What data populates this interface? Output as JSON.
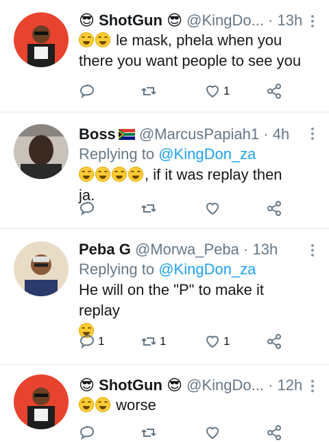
{
  "tweets": [
    {
      "name": "ShotGun",
      "name_emoji": "😎",
      "handle": "@KingDo...",
      "dot": "·",
      "time": "13h",
      "replying_to": "",
      "text": "le mask, phela when you there you want people to see you",
      "emojis_before": 2,
      "counts": {
        "reply": "",
        "retweet": "",
        "like": "1"
      }
    },
    {
      "name": "Boss",
      "flag": "south-africa-flag",
      "handle": "@MarcusPapiah1",
      "dot": "·",
      "time": "4h",
      "replying_prefix": "Replying to",
      "replying_to": "@KingDon_za",
      "text": ", if it was replay then ja.",
      "emojis_before": 4,
      "counts": {
        "reply": "",
        "retweet": "",
        "like": ""
      }
    },
    {
      "name": "Peba G",
      "handle": "@Morwa_Peba",
      "dot": "·",
      "time": "13h",
      "replying_prefix": "Replying to",
      "replying_to": "@KingDon_za",
      "text": "He will on the \"P\" to make it replay",
      "emojis_after": 1,
      "counts": {
        "reply": "1",
        "retweet": "1",
        "like": "1"
      }
    },
    {
      "name": "ShotGun",
      "name_emoji": "😎",
      "handle": "@KingDo...",
      "dot": "·",
      "time": "12h",
      "text": "worse",
      "emojis_before": 2,
      "counts": {
        "reply": "",
        "retweet": "",
        "like": ""
      }
    }
  ],
  "icons": {
    "reply": "reply-icon",
    "retweet": "retweet-icon",
    "like": "heart-icon",
    "share": "share-icon",
    "more": "more-vertical-icon"
  },
  "colors": {
    "mention": "#1da1f2",
    "secondary": "#657786",
    "divider": "#e1e8ed"
  }
}
